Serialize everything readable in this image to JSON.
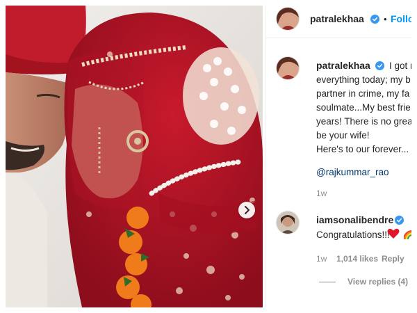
{
  "header": {
    "username": "patralekhaa",
    "verified_icon": "verified-badge-icon",
    "separator": "•",
    "follow_label": "Follow",
    "avatar_icon": "profile-avatar"
  },
  "caption": {
    "username": "patralekhaa",
    "lines": [
      "I got ma",
      "everything today; my b",
      "partner in crime, my fa",
      "soulmate...My best frie",
      "years! There is no great",
      "be your wife!",
      "Here's to our forever..."
    ],
    "mention": "@rajkummar_rao",
    "time": "1w"
  },
  "comment": {
    "username": "iamsonalibendre",
    "text": "Congratulations!!!",
    "emojis": [
      "heart-emoji",
      "rainbow-emoji"
    ],
    "time": "1w",
    "likes": "1,014 likes",
    "reply_label": "Reply",
    "view_replies": "View replies (4)"
  },
  "photo": {
    "alt_icon": "wedding-photo",
    "next_icon": "chevron-right-icon"
  },
  "colors": {
    "accent_blue": "#0095f6",
    "verified_blue": "#3897f0",
    "text_dark": "#262626",
    "text_muted": "#8e8e8e",
    "mention_blue": "#00376b",
    "saree_red": "#c8102e"
  }
}
